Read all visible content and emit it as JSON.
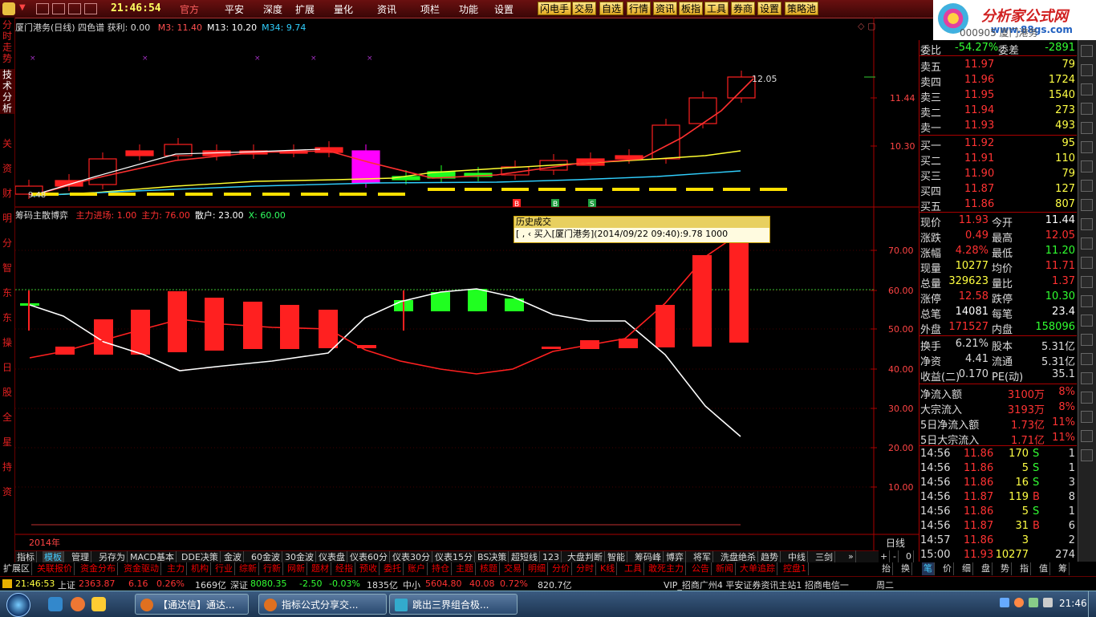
{
  "topbar": {
    "clock": "21:46:54",
    "menu": [
      "官方",
      "平安",
      "深度",
      "扩展",
      "量化",
      "资讯",
      "项栏",
      "功能",
      "设置"
    ],
    "active_menu": "官方",
    "buttons": [
      "闪电手",
      "交易",
      "自选",
      "行情",
      "资讯",
      "板指",
      "工具",
      "券商",
      "设置",
      "策略池"
    ]
  },
  "brand": {
    "name": "分析家公式网",
    "url": "www.88gs.com"
  },
  "left_tabs": {
    "upper": [
      "分时走势",
      "技术分析"
    ],
    "lower": [
      "关",
      "资",
      "财",
      "明",
      "分",
      "智",
      "东",
      "东",
      "操",
      "日",
      "股",
      "全",
      "星",
      "持",
      "资"
    ]
  },
  "main_chart": {
    "title": "厦门港务(日线)",
    "indicator": "四色谱",
    "profit_label": "获利: 0.00",
    "ma_labels": [
      {
        "text": "M3: 11.40",
        "color": "#ff5050"
      },
      {
        "text": "M13: 10.20",
        "color": "#ffffff"
      },
      {
        "text": "M34: 9.74",
        "color": "#30d0ff"
      }
    ],
    "price_axis": [
      "11.44",
      "10.30"
    ],
    "high_label": "12.05",
    "low_label": "9.48",
    "signal_marks": [
      "B",
      "B",
      "S"
    ]
  },
  "sub_chart": {
    "title": "筹码主散博弈",
    "labels": [
      {
        "text": "主力进场: 1.00",
        "color": "#ff3030"
      },
      {
        "text": "主力: 76.00",
        "color": "#ff3030"
      },
      {
        "text": "散户: 23.00",
        "color": "#ffffff"
      },
      {
        "text": "X: 60.00",
        "color": "#30ff60"
      }
    ],
    "axis": [
      "70.00",
      "60.00",
      "50.00",
      "40.00",
      "30.00",
      "20.00",
      "10.00"
    ],
    "year_label": "2014年",
    "period_label": "日线"
  },
  "tooltip": {
    "title": "历史成交",
    "text": "[ ,  ‹   买入[厦门港务](2014/09/22 09:40):9.78 1000"
  },
  "quote_panel": {
    "watermark": "000905 厦门港务",
    "ratio": {
      "label": "委比",
      "value": "-54.27%",
      "label2": "委差",
      "value2": "-2891"
    },
    "sells": [
      {
        "label": "卖五",
        "price": "11.97",
        "vol": "79"
      },
      {
        "label": "卖四",
        "price": "11.96",
        "vol": "1724"
      },
      {
        "label": "卖三",
        "price": "11.95",
        "vol": "1540"
      },
      {
        "label": "卖二",
        "price": "11.94",
        "vol": "273"
      },
      {
        "label": "卖一",
        "price": "11.93",
        "vol": "493"
      }
    ],
    "buys": [
      {
        "label": "买一",
        "price": "11.92",
        "vol": "95"
      },
      {
        "label": "买二",
        "price": "11.91",
        "vol": "110"
      },
      {
        "label": "买三",
        "price": "11.90",
        "vol": "79"
      },
      {
        "label": "买四",
        "price": "11.87",
        "vol": "127"
      },
      {
        "label": "买五",
        "price": "11.86",
        "vol": "807"
      }
    ],
    "stats": [
      {
        "l1": "现价",
        "v1": "11.93",
        "c1": "#ff3030",
        "l2": "今开",
        "v2": "11.44",
        "c2": "#ffffff"
      },
      {
        "l1": "涨跌",
        "v1": "0.49",
        "c1": "#ff3030",
        "l2": "最高",
        "v2": "12.05",
        "c2": "#ff3030"
      },
      {
        "l1": "涨幅",
        "v1": "4.28%",
        "c1": "#ff3030",
        "l2": "最低",
        "v2": "11.20",
        "c2": "#30ff30"
      },
      {
        "l1": "现量",
        "v1": "10277",
        "c1": "#ffff40",
        "l2": "均价",
        "v2": "11.71",
        "c2": "#ff3030"
      },
      {
        "l1": "总量",
        "v1": "329623",
        "c1": "#ffff40",
        "l2": "量比",
        "v2": "1.37",
        "c2": "#ff3030"
      },
      {
        "l1": "涨停",
        "v1": "12.58",
        "c1": "#ff3030",
        "l2": "跌停",
        "v2": "10.30",
        "c2": "#30ff30"
      },
      {
        "l1": "总笔",
        "v1": "14081",
        "c1": "#ffffff",
        "l2": "每笔",
        "v2": "23.4",
        "c2": "#ffffff"
      },
      {
        "l1": "外盘",
        "v1": "171527",
        "c1": "#ff3030",
        "l2": "内盘",
        "v2": "158096",
        "c2": "#30ff30"
      }
    ],
    "fundamentals": [
      {
        "l1": "换手",
        "v1": "6.21%",
        "l2": "股本",
        "v2": "5.31亿"
      },
      {
        "l1": "净资",
        "v1": "4.41",
        "l2": "流通",
        "v2": "5.31亿"
      },
      {
        "l1": "收益(二)",
        "v1": "0.170",
        "l2": "PE(动)",
        "v2": "35.1"
      }
    ],
    "flows": [
      {
        "label": "净流入额",
        "value": "3100万",
        "pct": "8%"
      },
      {
        "label": "大宗流入",
        "value": "3193万",
        "pct": "8%"
      },
      {
        "label": "5日净流入额",
        "value": "1.73亿",
        "pct": "11%"
      },
      {
        "label": "5日大宗流入",
        "value": "1.71亿",
        "pct": "11%"
      }
    ],
    "ticks": [
      {
        "time": "14:56",
        "price": "11.86",
        "vol": "170",
        "bs": "S",
        "n": "1"
      },
      {
        "time": "14:56",
        "price": "11.86",
        "vol": "5",
        "bs": "S",
        "n": "1"
      },
      {
        "time": "14:56",
        "price": "11.86",
        "vol": "16",
        "bs": "S",
        "n": "3"
      },
      {
        "time": "14:56",
        "price": "11.87",
        "vol": "119",
        "bs": "B",
        "n": "8"
      },
      {
        "time": "14:56",
        "price": "11.86",
        "vol": "5",
        "bs": "S",
        "n": "1"
      },
      {
        "time": "14:56",
        "price": "11.87",
        "vol": "31",
        "bs": "B",
        "n": "6"
      },
      {
        "time": "14:57",
        "price": "11.86",
        "vol": "3",
        "bs": "",
        "n": "2"
      },
      {
        "time": "15:00",
        "price": "11.93",
        "vol": "10277",
        "bs": "",
        "n": "274"
      }
    ],
    "bottom_tabs": [
      "笔",
      "价",
      "细",
      "盘",
      "势",
      "指",
      "值",
      "筹"
    ],
    "extra_tabs": [
      "抬",
      "换"
    ]
  },
  "tabbar1": [
    "指标",
    "模板",
    "管理",
    "另存为",
    "MACD基本",
    "DDE决策",
    "金波",
    "60金波",
    "30金波",
    "仪表盘",
    "仪表60分",
    "仪表30分",
    "仪表15分",
    "BS决策",
    "超短线",
    "123",
    "大盘判断",
    "智能",
    "筹码峰",
    "博弈",
    "将军",
    "洗盘绝杀",
    "趋势",
    "中线",
    "三剑"
  ],
  "tabbar1_selected": "模板",
  "tabbar1_controls": [
    "»",
    "+",
    "-",
    "0"
  ],
  "tabbar2": [
    "扩展区",
    "关联报价",
    "资金分布",
    "资金驱动",
    "主力",
    "机构",
    "行业",
    "综新",
    "行新",
    "网新",
    "题材",
    "经指",
    "预收",
    "委托",
    "账户",
    "持仓",
    "主题",
    "核题",
    "交易",
    "明细",
    "分价",
    "分时",
    "K线",
    "工具",
    "敢死主力",
    "公告",
    "新闻",
    "大单追踪",
    "控盘1"
  ],
  "statusbar": {
    "time": "21:46:53",
    "sh_label": "上证",
    "sh_value": "2363.87",
    "sh_change": "6.16",
    "sh_pct": "0.26%",
    "sh_amount": "1669亿",
    "sz_label": "深证",
    "sz_value": "8080.35",
    "sz_change": "-2.50",
    "sz_pct": "-0.03%",
    "sz_amount": "1835亿",
    "zx_label": "中小",
    "zx_value": "5604.80",
    "zx_change": "40.08",
    "zx_pct": "0.72%",
    "zx_amount": "820.7亿",
    "server": "VIP_招商广州4 平安证券资讯主站1 招商电信一",
    "weekday": "周二"
  },
  "taskbar": {
    "tasks": [
      "【通达信】通达...",
      "指标公式分享交...",
      "跳出三界组合极..."
    ],
    "clock": "21:46"
  },
  "colors": {
    "up": "#ff2020",
    "down": "#20ff20",
    "accent": "#ffff40",
    "ma_yellow": "#ffff30",
    "ma_cyan": "#30d0ff"
  }
}
